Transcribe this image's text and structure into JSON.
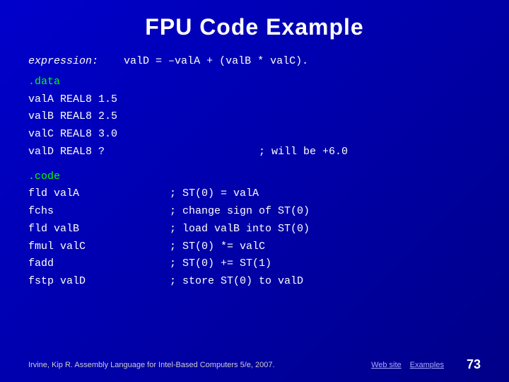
{
  "title": "FPU Code Example",
  "expression_label": "expression:",
  "expression_value": "valD = –valA + (valB * valC).",
  "data_directive": ".data",
  "data_lines": [
    {
      "name": "valA",
      "type": "REAL8",
      "value": "1.5",
      "comment": ""
    },
    {
      "name": "valB",
      "type": "REAL8",
      "value": "2.5",
      "comment": ""
    },
    {
      "name": "valC",
      "type": "REAL8",
      "value": "3.0",
      "comment": ""
    },
    {
      "name": "valD",
      "type": "REAL8",
      "value": "?",
      "comment": "; will be +6.0"
    }
  ],
  "code_directive": ".code",
  "code_lines": [
    {
      "cmd": "fld  valA",
      "comment": "; ST(0) = valA"
    },
    {
      "cmd": "fchs",
      "comment": "; change sign of ST(0)"
    },
    {
      "cmd": "fld  valB",
      "comment": "; load valB into ST(0)"
    },
    {
      "cmd": "fmul valC",
      "comment": "; ST(0) *= valC"
    },
    {
      "cmd": "fadd",
      "comment": "; ST(0) += ST(1)"
    },
    {
      "cmd": "fstp valD",
      "comment": "; store ST(0) to valD"
    }
  ],
  "footer": {
    "citation": "Irvine, Kip R. Assembly Language for Intel-Based Computers 5/e, 2007.",
    "web_site": "Web site",
    "examples": "Examples",
    "page_number": "73"
  }
}
